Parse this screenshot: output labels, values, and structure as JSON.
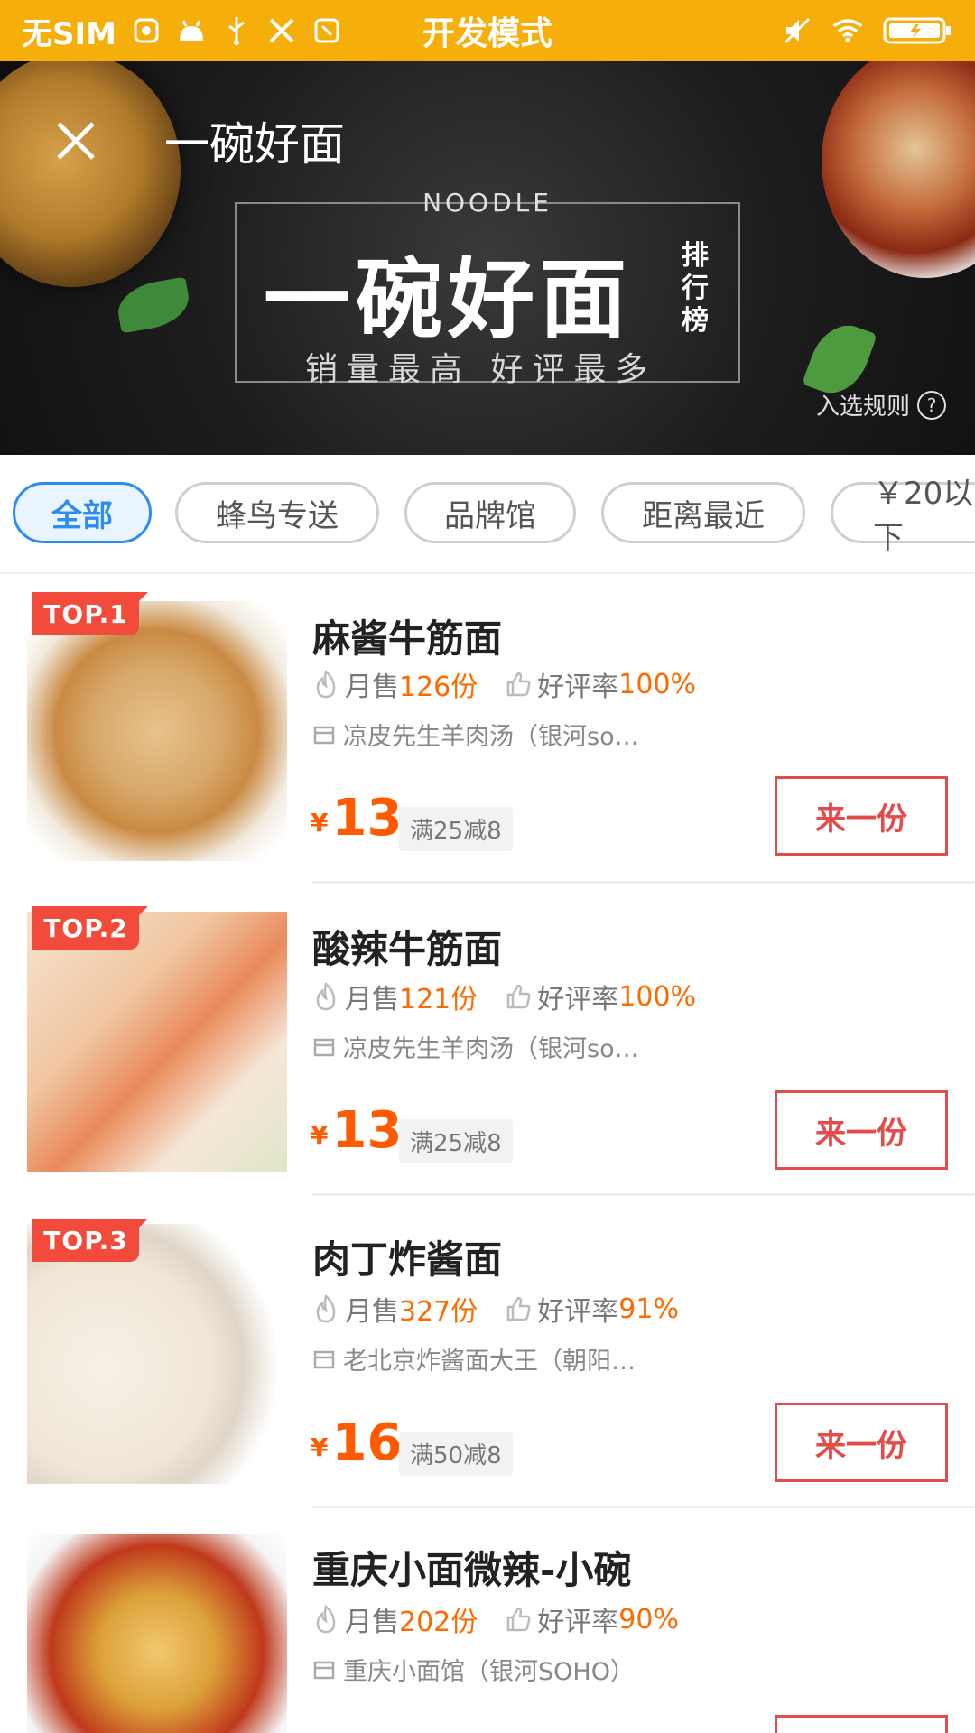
{
  "status_bar": {
    "carrier": "无SIM",
    "mode": "开发模式"
  },
  "banner": {
    "title": "一碗好面",
    "noodle_word": "NOODLE",
    "big_title": "一碗好面",
    "vertical_label": "排行榜",
    "slogan": "销量最高 好评最多",
    "rules_label": "入选规则",
    "rules_icon_glyph": "?"
  },
  "filters": [
    {
      "label": "全部",
      "active": true
    },
    {
      "label": "蜂鸟专送",
      "active": false
    },
    {
      "label": "品牌馆",
      "active": false
    },
    {
      "label": "距离最近",
      "active": false
    },
    {
      "label": "￥20以下",
      "active": false
    }
  ],
  "items": [
    {
      "rank": "TOP.1",
      "name": "麻酱牛筋面",
      "monthly_label": "月售",
      "monthly_value": "126份",
      "rating_label": "好评率",
      "rating_value": "100%",
      "shop": "凉皮先生羊肉汤（银河so…",
      "currency": "¥",
      "price": "13",
      "promo": "满25减8",
      "buy_label": "来一份"
    },
    {
      "rank": "TOP.2",
      "name": "酸辣牛筋面",
      "monthly_label": "月售",
      "monthly_value": "121份",
      "rating_label": "好评率",
      "rating_value": "100%",
      "shop": "凉皮先生羊肉汤（银河so…",
      "currency": "¥",
      "price": "13",
      "promo": "满25减8",
      "buy_label": "来一份"
    },
    {
      "rank": "TOP.3",
      "name": "肉丁炸酱面",
      "monthly_label": "月售",
      "monthly_value": "327份",
      "rating_label": "好评率",
      "rating_value": "91%",
      "shop": "老北京炸酱面大王（朝阳…",
      "currency": "¥",
      "price": "16",
      "promo": "满50减8",
      "buy_label": "来一份"
    },
    {
      "rank": "",
      "name": "重庆小面微辣-小碗",
      "monthly_label": "月售",
      "monthly_value": "202份",
      "rating_label": "好评率",
      "rating_value": "90%",
      "shop": "重庆小面馆（银河SOHO）",
      "currency": "",
      "price": "",
      "promo": "",
      "buy_label": ""
    }
  ],
  "colors": {
    "status_bar": "#F5AE0A",
    "accent_orange": "#ff6a00",
    "chip_active": "#2c8cf0",
    "buy_red": "#e44b4b",
    "badge_red": "#f24b3b"
  },
  "icons": {
    "close": "close-icon",
    "flame": "flame-icon",
    "thumbs_up": "thumbs-up-icon",
    "shop": "shop-icon",
    "help": "help-icon"
  }
}
